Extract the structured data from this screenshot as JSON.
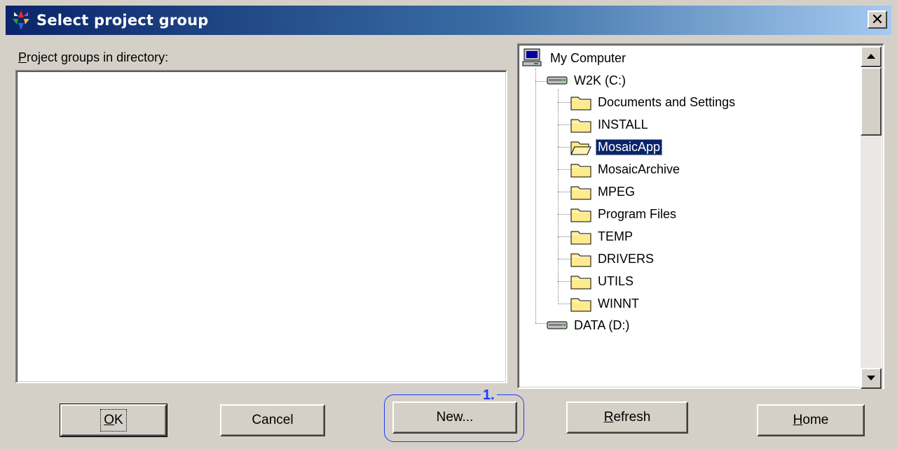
{
  "window": {
    "title": "Select project group",
    "close_glyph": "✕"
  },
  "list": {
    "label_prefix": "P",
    "label_rest": "roject groups in directory:",
    "items": []
  },
  "tree": {
    "root": "My Computer",
    "drives": [
      {
        "label": "W2K (C:)",
        "expanded": true
      },
      {
        "label": "DATA (D:)",
        "expanded": false
      }
    ],
    "folders": [
      "Documents and Settings",
      "INSTALL",
      "MosaicApp",
      "MosaicArchive",
      "MPEG",
      "Program Files",
      "TEMP",
      "DRIVERS",
      "UTILS",
      "WINNT"
    ],
    "selected": "MosaicApp",
    "icons": {
      "root": "my-computer-icon",
      "drive": "hard-drive-icon",
      "folder": "folder-icon",
      "folder_open": "folder-open-icon"
    }
  },
  "buttons": {
    "ok_u": "O",
    "ok_rest": "K",
    "cancel": "Cancel",
    "new": "New...",
    "refresh_u": "R",
    "refresh_rest": "efresh",
    "home_u": "H",
    "home_rest": "ome"
  },
  "annotation": {
    "number": "1.",
    "color": "#1a3cff"
  },
  "colors": {
    "titlebar_start": "#0a246a",
    "titlebar_end": "#a6caf0",
    "selection": "#0a246a",
    "face": "#d4d0c8"
  }
}
